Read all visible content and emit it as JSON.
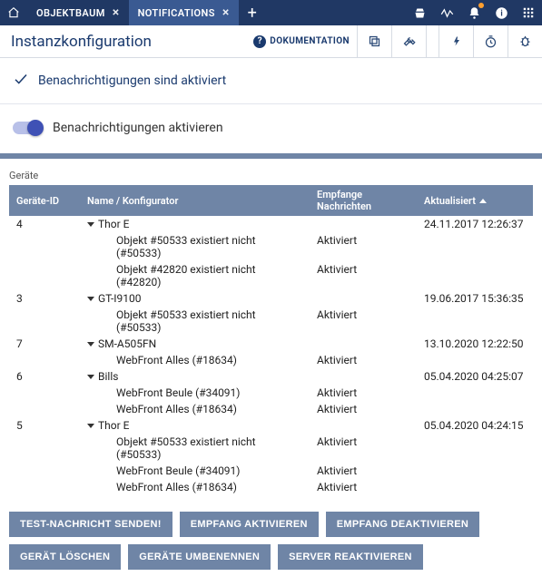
{
  "tabs": {
    "items": [
      {
        "label": "OBJEKTBAUM",
        "active": false
      },
      {
        "label": "NOTIFICATIONS",
        "active": true
      }
    ]
  },
  "toolbar": {
    "title": "Instanzkonfiguration",
    "doc_label": "DOKUMENTATION"
  },
  "status": {
    "text": "Benachrichtigungen sind aktiviert"
  },
  "toggle": {
    "label": "Benachrichtigungen aktivieren",
    "on": true
  },
  "devices": {
    "section_label": "Geräte",
    "columns": {
      "id": "Geräte-ID",
      "name": "Name / Konfigurator",
      "recv": "Empfange Nachrichten",
      "updated": "Aktualisiert"
    },
    "rows": [
      {
        "id": "4",
        "name": "Thor E",
        "updated": "24.11.2017 12:26:37",
        "children": [
          {
            "name": "Objekt #50533 existiert nicht (#50533)",
            "recv": "Aktiviert"
          },
          {
            "name": "Objekt #42820 existiert nicht (#42820)",
            "recv": "Aktiviert"
          }
        ]
      },
      {
        "id": "3",
        "name": "GT-I9100",
        "updated": "19.06.2017 15:36:35",
        "children": [
          {
            "name": "Objekt #50533 existiert nicht (#50533)",
            "recv": "Aktiviert"
          }
        ]
      },
      {
        "id": "7",
        "name": "SM-A505FN",
        "updated": "13.10.2020 12:22:50",
        "children": [
          {
            "name": "WebFront Alles (#18634)",
            "recv": "Aktiviert"
          }
        ]
      },
      {
        "id": "6",
        "name": "Bills",
        "updated": "05.04.2020 04:25:07",
        "children": [
          {
            "name": "WebFront Beule (#34091)",
            "recv": "Aktiviert"
          },
          {
            "name": "WebFront Alles (#18634)",
            "recv": "Aktiviert"
          }
        ]
      },
      {
        "id": "5",
        "name": "Thor E",
        "updated": "05.04.2020 04:24:15",
        "children": [
          {
            "name": "Objekt #50533 existiert nicht (#50533)",
            "recv": "Aktiviert"
          },
          {
            "name": "WebFront Beule (#34091)",
            "recv": "Aktiviert"
          },
          {
            "name": "WebFront Alles (#18634)",
            "recv": "Aktiviert"
          }
        ]
      }
    ]
  },
  "actions": {
    "test_message": "TEST-NACHRICHT SENDEN!",
    "recv_on": "EMPFANG AKTIVIEREN",
    "recv_off": "EMPFANG DEAKTIVIEREN",
    "delete_device": "GERÄT LÖSCHEN",
    "rename_devices": "GERÄTE UMBENENNEN",
    "reactivate_server": "SERVER REAKTIVIEREN"
  }
}
